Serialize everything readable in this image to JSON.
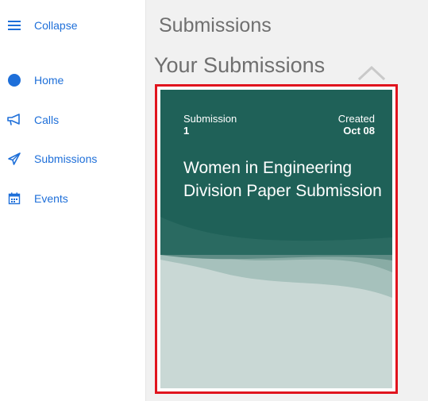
{
  "sidebar": {
    "collapse_label": "Collapse",
    "items": [
      {
        "label": "Home",
        "icon": "home-circle-icon"
      },
      {
        "label": "Calls",
        "icon": "megaphone-icon"
      },
      {
        "label": "Submissions",
        "icon": "paper-plane-icon"
      },
      {
        "label": "Events",
        "icon": "calendar-icon"
      }
    ]
  },
  "main": {
    "page_title": "Submissions",
    "section_title": "Your Submissions",
    "card": {
      "submission_label": "Submission",
      "submission_number": "1",
      "created_label": "Created",
      "created_date": "Oct 08",
      "title": "Women in Engineering Division Paper Submission"
    }
  },
  "colors": {
    "accent": "#1e6fd9",
    "card_dark": "#1f6158",
    "highlight_border": "#e0141e"
  }
}
